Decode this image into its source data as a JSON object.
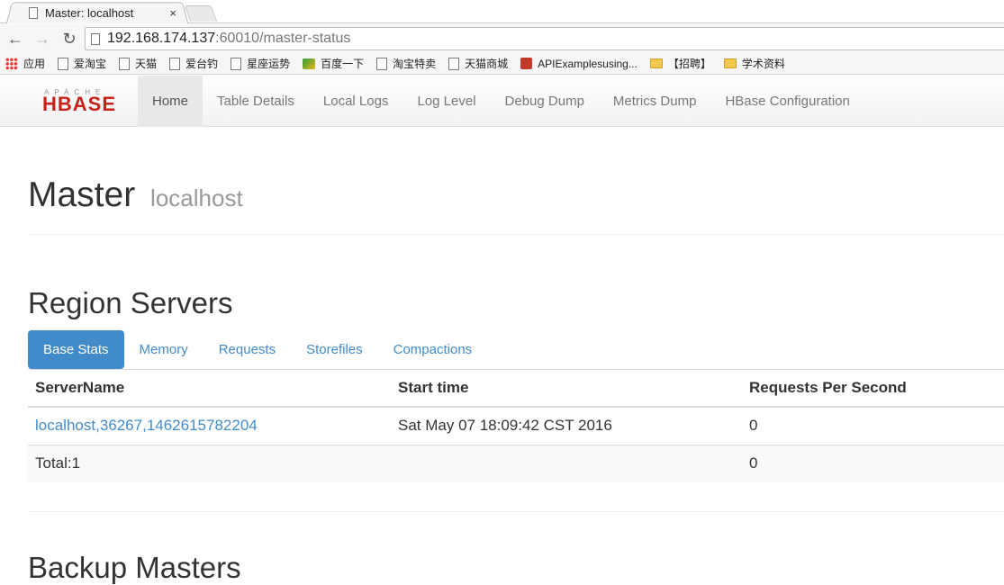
{
  "browser": {
    "tab_title": "Master: localhost",
    "tab_close": "×",
    "url_host": "192.168.174.137",
    "url_path": ":60010/master-status",
    "bookmarks": [
      {
        "label": "应用",
        "icon": "apps-icon"
      },
      {
        "label": "爱淘宝",
        "icon": "page-icon"
      },
      {
        "label": "天猫",
        "icon": "page-icon"
      },
      {
        "label": "爱台钓",
        "icon": "page-icon"
      },
      {
        "label": "星座运势",
        "icon": "page-icon"
      },
      {
        "label": "百度一下",
        "icon": "baidu-icon"
      },
      {
        "label": "淘宝特卖",
        "icon": "page-icon"
      },
      {
        "label": "天猫商城",
        "icon": "page-icon"
      },
      {
        "label": "APIExamplesusing...",
        "icon": "red-square-icon"
      },
      {
        "label": "【招聘】",
        "icon": "folder-icon"
      },
      {
        "label": "学术资料",
        "icon": "folder-icon"
      }
    ]
  },
  "navbar": {
    "logo_top": "APACHE",
    "logo_main": "HBASE",
    "links": [
      "Home",
      "Table Details",
      "Local Logs",
      "Log Level",
      "Debug Dump",
      "Metrics Dump",
      "HBase Configuration"
    ],
    "active_index": 0
  },
  "header": {
    "title": "Master",
    "subtitle": "localhost"
  },
  "region_servers": {
    "title": "Region Servers",
    "tabs": [
      "Base Stats",
      "Memory",
      "Requests",
      "Storefiles",
      "Compactions"
    ],
    "active_tab": 0,
    "columns": [
      "ServerName",
      "Start time",
      "Requests Per Second"
    ],
    "rows": [
      [
        "localhost,36267,1462615782204",
        "Sat May 07 18:09:42 CST 2016",
        "0"
      ]
    ],
    "total": [
      "Total:1",
      "",
      "0"
    ]
  },
  "backup_masters": {
    "title": "Backup Masters"
  },
  "colors": {
    "link": "#428bca",
    "brand": "#c8221a"
  }
}
